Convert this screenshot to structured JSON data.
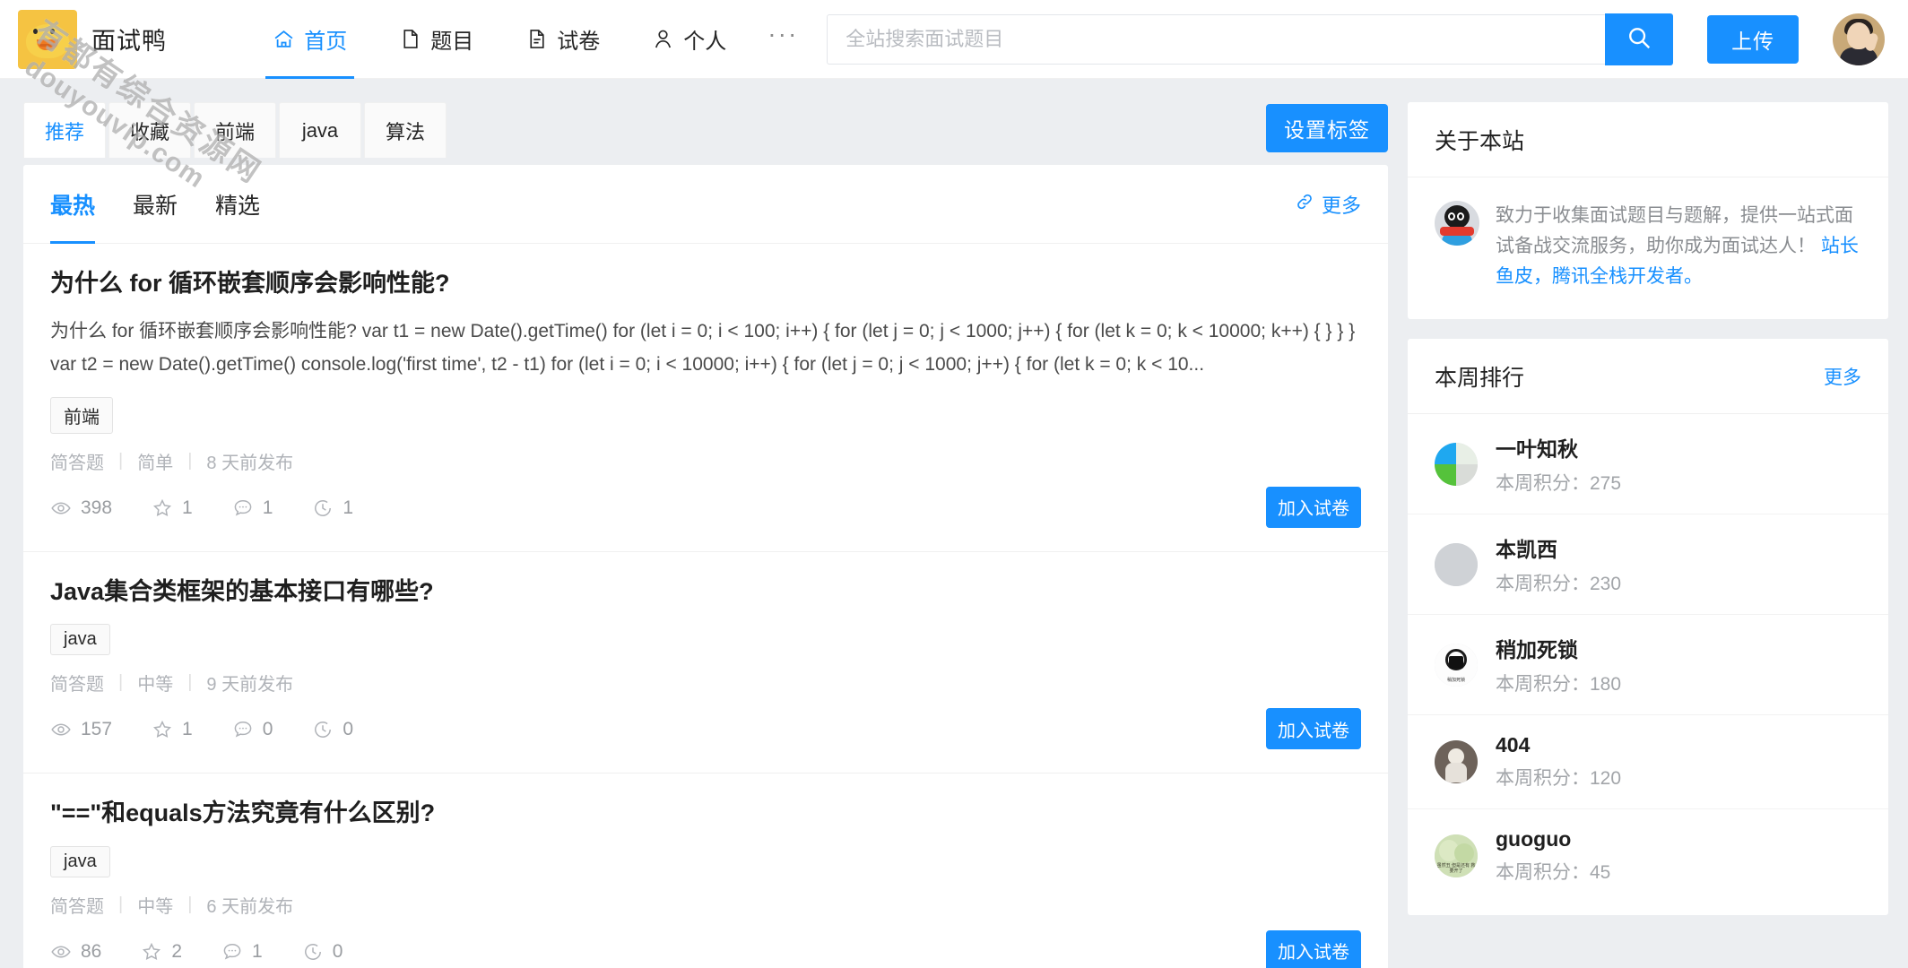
{
  "header": {
    "brand_name": "面试鸭",
    "brand_logo_icon": "duck-logo-icon",
    "nav": [
      {
        "label": "首页",
        "icon": "home-icon",
        "active": true
      },
      {
        "label": "题目",
        "icon": "file-icon",
        "active": false
      },
      {
        "label": "试卷",
        "icon": "document-icon",
        "active": false
      },
      {
        "label": "个人",
        "icon": "user-icon",
        "active": false
      }
    ],
    "more_nav": "···",
    "search": {
      "placeholder": "全站搜索面试题目",
      "value": "",
      "button_icon": "search-icon"
    },
    "upload_label": "上传",
    "avatar_alt": "user-avatar"
  },
  "watermark": {
    "cn": "有都有综合资源网",
    "en": "douyouvip.com"
  },
  "tagbar": {
    "tabs": [
      {
        "label": "推荐",
        "active": true
      },
      {
        "label": "收藏",
        "active": false
      },
      {
        "label": "前端",
        "active": false
      },
      {
        "label": "java",
        "active": false
      },
      {
        "label": "算法",
        "active": false
      }
    ],
    "set_tag_label": "设置标签"
  },
  "sort": {
    "tabs": [
      {
        "label": "最热",
        "active": true
      },
      {
        "label": "最新",
        "active": false
      },
      {
        "label": "精选",
        "active": false
      }
    ],
    "more_label": "更多",
    "more_icon": "link-icon"
  },
  "questions": [
    {
      "title": "为什么 for 循环嵌套顺序会影响性能?",
      "desc": "为什么 for 循环嵌套顺序会影响性能?  var t1 = new Date().getTime() for (let i = 0; i < 100; i++) { for (let j = 0; j < 1000; j++) { for (let k = 0; k < 10000; k++) { } } } var t2 = new Date().getTime() console.log('first time', t2 - t1) for (let i = 0; i < 10000; i++) { for (let j = 0; j < 1000; j++) { for (let k = 0; k < 10...",
      "tag": "前端",
      "type": "简答题",
      "difficulty": "简单",
      "published": "8 天前发布",
      "views": "398",
      "stars": "1",
      "comments": "1",
      "history": "1",
      "join_label": "加入试卷"
    },
    {
      "title": "Java集合类框架的基本接口有哪些?",
      "desc": "",
      "tag": "java",
      "type": "简答题",
      "difficulty": "中等",
      "published": "9 天前发布",
      "views": "157",
      "stars": "1",
      "comments": "0",
      "history": "0",
      "join_label": "加入试卷"
    },
    {
      "title": "\"==\"和equals方法究竟有什么区别?",
      "desc": "",
      "tag": "java",
      "type": "简答题",
      "difficulty": "中等",
      "published": "6 天前发布",
      "views": "86",
      "stars": "2",
      "comments": "1",
      "history": "0",
      "join_label": "加入试卷"
    }
  ],
  "about": {
    "title": "关于本站",
    "avatar_icon": "qq-penguin-icon",
    "text_before": "致力于收集面试题目与题解，提供一站式面试备战交流服务，助你成为面试达人！ ",
    "link1": "站长鱼皮，",
    "link2": "腾讯全栈开发者。"
  },
  "rank": {
    "title": "本周排行",
    "more_label": "更多",
    "score_label": "本周积分：",
    "items": [
      {
        "name": "一叶知秋",
        "score": "275",
        "avatar": "quad-avatar"
      },
      {
        "name": "本凯西",
        "score": "230",
        "avatar": "plain-avatar"
      },
      {
        "name": "稍加死锁",
        "score": "180",
        "avatar": "lock-avatar",
        "avatar_caption": "稍加死锁"
      },
      {
        "name": "404",
        "score": "120",
        "avatar": "astro-avatar"
      },
      {
        "name": "guoguo",
        "score": "45",
        "avatar": "green-avatar",
        "avatar_caption": "虽然丑 但是还有 救要开了"
      }
    ]
  },
  "colors": {
    "accent": "#1890ff",
    "page_bg": "#eceef1",
    "panel_bg": "#ffffff",
    "muted_text": "#a2a5a9"
  }
}
